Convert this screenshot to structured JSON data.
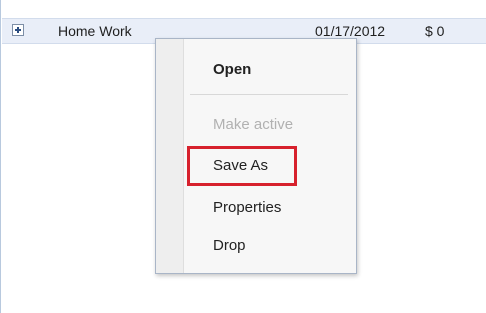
{
  "row": {
    "name": "Home Work",
    "date": "01/17/2012",
    "amount": "$ 0"
  },
  "context_menu": {
    "items": [
      {
        "label": "Open",
        "state": "default"
      },
      {
        "label": "Make active",
        "state": "disabled"
      },
      {
        "label": "Save As",
        "state": "highlighted"
      },
      {
        "label": "Properties",
        "state": "default"
      },
      {
        "label": "Drop",
        "state": "default"
      }
    ]
  },
  "colors": {
    "row_background": "#e9eef8",
    "menu_background": "#f7f7f7",
    "highlight": "#d7212d"
  }
}
